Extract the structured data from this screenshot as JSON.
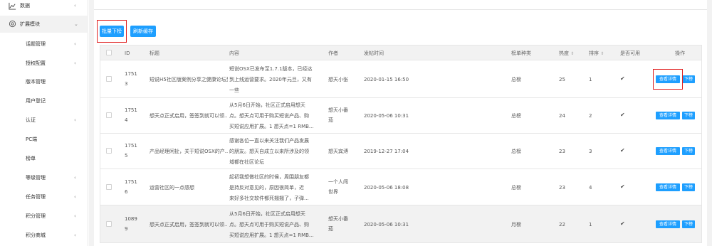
{
  "sidebar": {
    "items": [
      {
        "label": "数据",
        "chev": "‹"
      },
      {
        "label": "扩展模块",
        "chev": "⌄"
      },
      {
        "label": "话题管理",
        "chev": "‹"
      },
      {
        "label": "授权配置",
        "chev": "‹"
      },
      {
        "label": "版本管理",
        "chev": ""
      },
      {
        "label": "用户登记",
        "chev": ""
      },
      {
        "label": "认证",
        "chev": "‹"
      },
      {
        "label": "PC端",
        "chev": ""
      },
      {
        "label": "榜单",
        "chev": ""
      },
      {
        "label": "等级管理",
        "chev": "‹"
      },
      {
        "label": "任务管理",
        "chev": "‹"
      },
      {
        "label": "积分管理",
        "chev": "‹"
      },
      {
        "label": "积分商城",
        "chev": "‹"
      }
    ]
  },
  "toolbar": {
    "batch_label": "批量下榜",
    "refresh_label": "刷新缓存"
  },
  "table": {
    "headers": {
      "id": "ID",
      "title": "标题",
      "content": "内容",
      "author": "作者",
      "time": "发帖时间",
      "rank_type": "榜单种类",
      "heat": "热度",
      "order": "排序",
      "enabled": "是否可用",
      "ops": "操作",
      "sort_glyph": "⇕"
    },
    "view_label": "查看详情",
    "down_label": "下榜",
    "rows": [
      {
        "id1": "1751",
        "id2": "3",
        "title": "短说H5社区版案例分享之健康论坛到上线运营...",
        "c1": "短说OSX已发布至1.7.1版本，已经达",
        "c2": "到上线运营要求。2020年元旦，又有",
        "c3": "一些",
        "a1": "想天小张",
        "a2": "",
        "time": "2020-01-15 16:50",
        "type": "总榜",
        "heat": "25",
        "order": "1",
        "tick": "✔"
      },
      {
        "id1": "1751",
        "id2": "4",
        "title": "想天点正式启用，签签到就可以领...",
        "c1": "从5月6日开始，社区正式启用想天",
        "c2": "点。想天点可用于购买短说产品、购",
        "c3": "买短说应用扩展。1 想天点=1 RMB...",
        "a1": "想天小番",
        "a2": "茄",
        "time": "2020-05-06 10:31",
        "type": "总榜",
        "heat": "24",
        "order": "2",
        "tick": "✔"
      },
      {
        "id1": "1751",
        "id2": "5",
        "title": "产品经理闲扯，关于短说OSX的产...",
        "c1": "感谢各位一直以来关注我们产品发展",
        "c2": "的朋友。想天自成立以来所涉及的领",
        "c3": "域都在社区论坛",
        "a1": "想天宾溥",
        "a2": "",
        "time": "2019-12-27 17:04",
        "type": "总榜",
        "heat": "23",
        "order": "3",
        "tick": "✔"
      },
      {
        "id1": "1751",
        "id2": "6",
        "title": "运营社区的一点感想",
        "c1": "起初我想做社区的时候，周围朋友都",
        "c2": "是持反对意见的，原因很简单，近",
        "c3": "来好多社交软件都死翘翘了，子弹...",
        "a1": "一个人闯",
        "a2": "世界",
        "time": "2020-05-06 18:08",
        "type": "总榜",
        "heat": "23",
        "order": "4",
        "tick": "✔"
      },
      {
        "id1": "1089",
        "id2": "9",
        "title": "想天点正式启用，签签到就可以领...",
        "c1": "从5月6日开始，社区正式启用想天",
        "c2": "点。想天点可用于购买短说产品、购",
        "c3": "买短说应用扩展。1 想天点=1 RMB...",
        "a1": "想天小番",
        "a2": "茄",
        "time": "2020-05-06 10:31",
        "type": "月榜",
        "heat": "22",
        "order": "1",
        "tick": "✔"
      }
    ]
  },
  "colors": {
    "accent": "#1e9fff",
    "highlight": "#e02020"
  },
  "icons": {
    "data": "chart-icon",
    "ext": "gear-icon"
  }
}
